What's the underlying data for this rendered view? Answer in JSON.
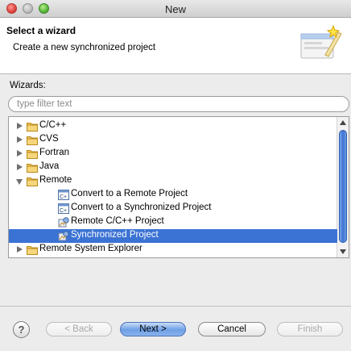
{
  "window": {
    "title": "New"
  },
  "header": {
    "title": "Select a wizard",
    "subtitle": "Create a new synchronized project"
  },
  "wizards_label": "Wizards:",
  "filter": {
    "placeholder": "type filter text",
    "value": ""
  },
  "tree": {
    "items": [
      {
        "label": "C/C++",
        "level": 0,
        "type": "folder",
        "expanded": false,
        "selected": false
      },
      {
        "label": "CVS",
        "level": 0,
        "type": "folder",
        "expanded": false,
        "selected": false
      },
      {
        "label": "Fortran",
        "level": 0,
        "type": "folder",
        "expanded": false,
        "selected": false
      },
      {
        "label": "Java",
        "level": 0,
        "type": "folder",
        "expanded": false,
        "selected": false
      },
      {
        "label": "Remote",
        "level": 0,
        "type": "folder",
        "expanded": true,
        "selected": false
      },
      {
        "label": "Convert to a Remote Project",
        "level": 1,
        "type": "convert",
        "selected": false
      },
      {
        "label": "Convert to a Synchronized Project",
        "level": 1,
        "type": "convert",
        "selected": false
      },
      {
        "label": "Remote C/C++ Project",
        "level": 1,
        "type": "project",
        "selected": false
      },
      {
        "label": "Synchronized Project",
        "level": 1,
        "type": "project",
        "selected": true
      },
      {
        "label": "Remote System Explorer",
        "level": 0,
        "type": "folder",
        "expanded": false,
        "selected": false
      }
    ]
  },
  "buttons": {
    "help": "?",
    "back": "< Back",
    "next": "Next >",
    "cancel": "Cancel",
    "finish": "Finish"
  },
  "colors": {
    "selection": "#3b73d4",
    "folder": "#e8b84a"
  }
}
